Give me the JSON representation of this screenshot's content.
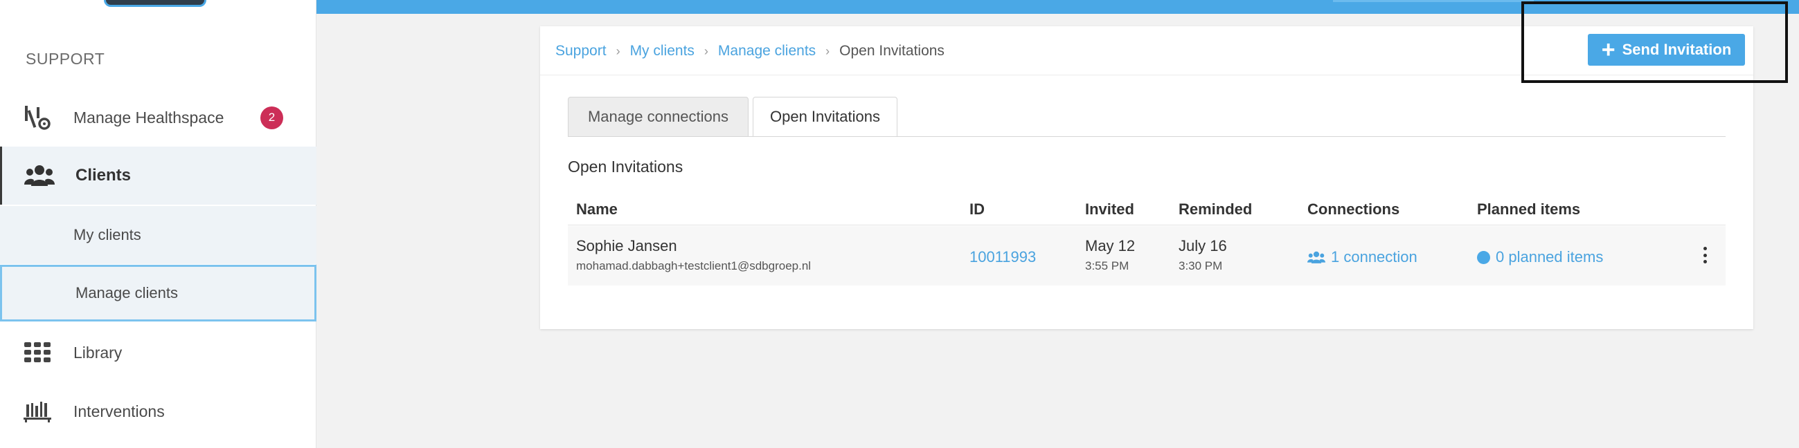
{
  "sidebar": {
    "section_title": "SUPPORT",
    "items": [
      {
        "label": "Manage Healthspace",
        "icon": "healthspace-settings-icon",
        "badge": "2"
      },
      {
        "label": "Clients",
        "icon": "users-icon"
      },
      {
        "label": "My clients"
      },
      {
        "label": "Manage clients"
      },
      {
        "label": "Library",
        "icon": "grid-icon"
      },
      {
        "label": "Interventions",
        "icon": "bookshelf-icon"
      }
    ]
  },
  "breadcrumb": {
    "items": [
      "Support",
      "My clients",
      "Manage clients"
    ],
    "current": "Open Invitations"
  },
  "send_invitation": {
    "icon": "plus",
    "label": "Send Invitation"
  },
  "tabs": [
    {
      "label": "Manage connections",
      "active": false
    },
    {
      "label": "Open Invitations",
      "active": true
    }
  ],
  "section_heading": "Open Invitations",
  "table": {
    "headers": [
      "Name",
      "ID",
      "Invited",
      "Reminded",
      "Connections",
      "Planned items"
    ],
    "rows": [
      {
        "name": "Sophie Jansen",
        "email": "mohamad.dabbagh+testclient1@sdbgroep.nl",
        "id": "10011993",
        "invited_date": "May 12",
        "invited_time": "3:55 PM",
        "reminded_date": "July 16",
        "reminded_time": "3:30 PM",
        "connections": "1 connection",
        "planned_items": "0 planned items"
      }
    ]
  },
  "colors": {
    "accent": "#4aa8e6",
    "link": "#4aa3df",
    "badge": "#cc2e57",
    "sidebar_active_bg": "#eef3f7"
  }
}
